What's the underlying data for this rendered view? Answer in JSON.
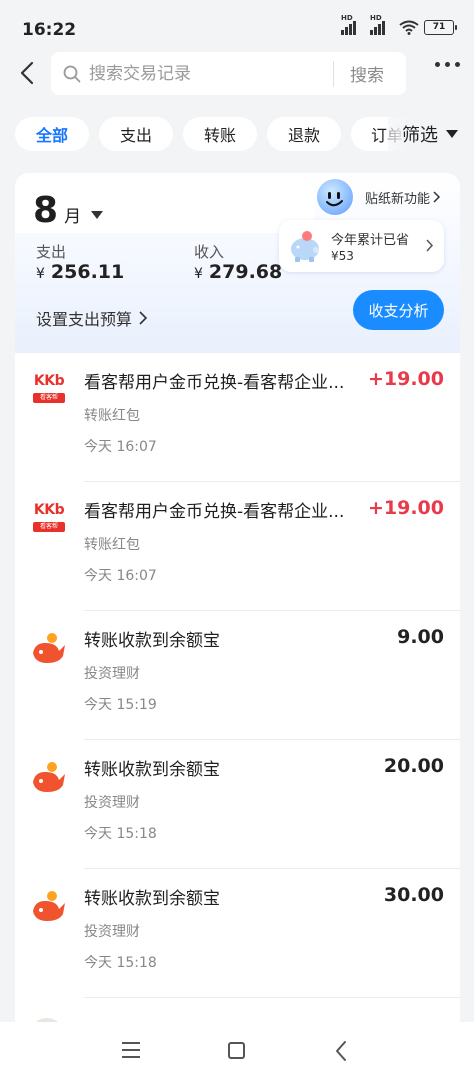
{
  "status_bar": {
    "time": "16:22",
    "battery": "71",
    "hd1": "HD",
    "hd2": "HD"
  },
  "search": {
    "placeholder": "搜索交易记录",
    "button": "搜索"
  },
  "tabs": [
    {
      "label": "全部"
    },
    {
      "label": "支出"
    },
    {
      "label": "转账"
    },
    {
      "label": "退款"
    },
    {
      "label": "订单"
    }
  ],
  "filter": {
    "label": "筛选"
  },
  "summary": {
    "month_num": "8",
    "month_unit": "月",
    "expense_label": "支出",
    "expense_currency": "¥",
    "expense_value": "256.11",
    "income_label": "收入",
    "income_currency": "¥",
    "income_value": "279.68",
    "budget_link": "设置支出预算",
    "sticker_label": "贴纸新功能",
    "saved_title": "今年累计已省",
    "saved_amount": "¥53",
    "analysis_button": "收支分析"
  },
  "transactions": [
    {
      "title": "看客帮用户金币兑换-看客帮企业...",
      "category": "转账红包",
      "time": "今天 16:07",
      "amount": "+19.00",
      "kind": "income",
      "icon": "kkb-logo",
      "logo_text": "KKb",
      "logo_sub": "看客帮"
    },
    {
      "title": "看客帮用户金币兑换-看客帮企业...",
      "category": "转账红包",
      "time": "今天 16:07",
      "amount": "+19.00",
      "kind": "income",
      "icon": "kkb-logo",
      "logo_text": "KKb",
      "logo_sub": "看客帮"
    },
    {
      "title": "转账收款到余额宝",
      "category": "投资理财",
      "time": "今天 15:19",
      "amount": "9.00",
      "kind": "neutral",
      "icon": "yuebao-icon"
    },
    {
      "title": "转账收款到余额宝",
      "category": "投资理财",
      "time": "今天 15:18",
      "amount": "20.00",
      "kind": "neutral",
      "icon": "yuebao-icon"
    },
    {
      "title": "转账收款到余额宝",
      "category": "投资理财",
      "time": "今天 15:18",
      "amount": "30.00",
      "kind": "neutral",
      "icon": "yuebao-icon"
    }
  ],
  "colors": {
    "accent": "#1677ff",
    "income": "#e83a4a",
    "button": "#1a8cff",
    "yuebao": "#f0532d"
  }
}
